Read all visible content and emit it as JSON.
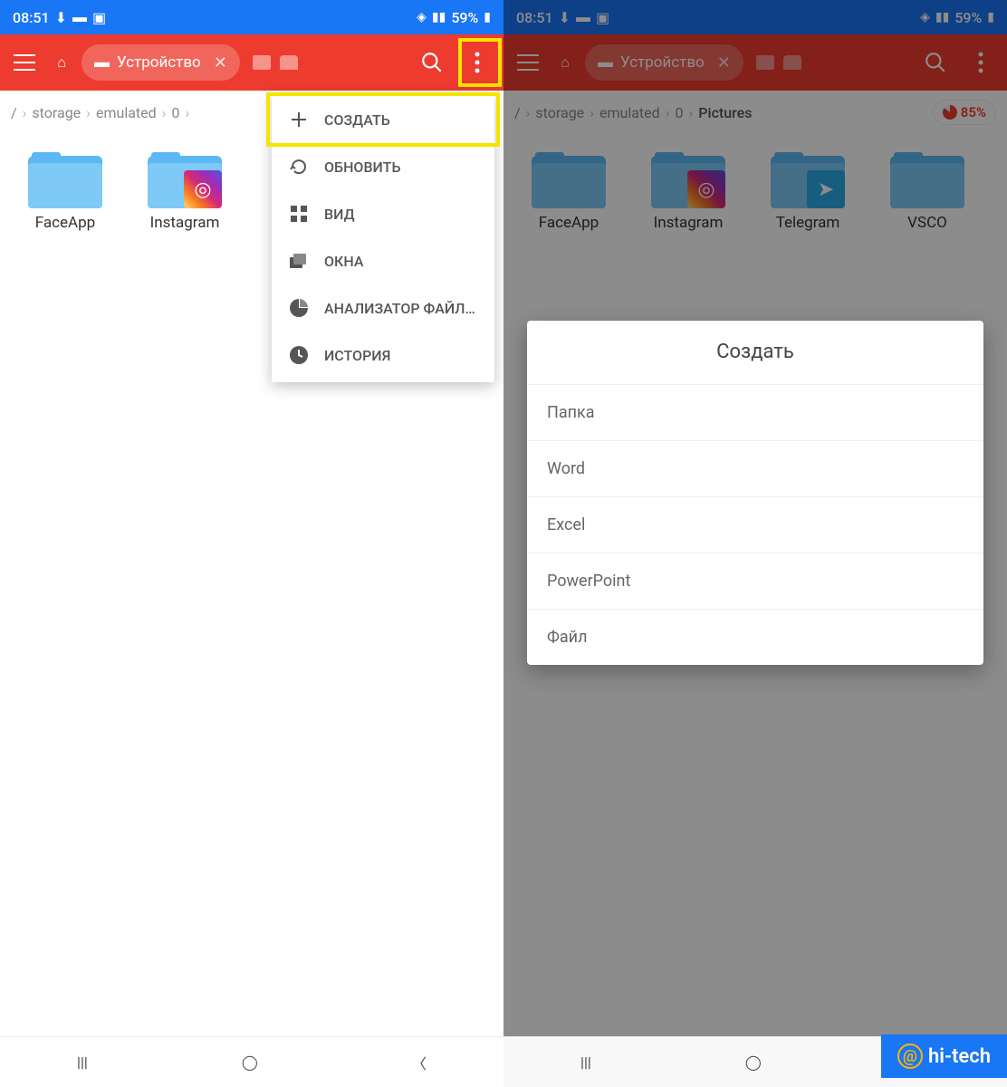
{
  "status": {
    "time": "08:51",
    "battery": "59%"
  },
  "appbar": {
    "device_label": "Устройство"
  },
  "breadcrumb_left": [
    "storage",
    "emulated",
    "0"
  ],
  "breadcrumb_right": [
    "storage",
    "emulated",
    "0",
    "Pictures"
  ],
  "storage_pct": "85%",
  "folders_left": [
    {
      "name": "FaceApp",
      "overlay": null
    },
    {
      "name": "Instagram",
      "overlay": "ig"
    }
  ],
  "folders_right": [
    {
      "name": "FaceApp",
      "overlay": null
    },
    {
      "name": "Instagram",
      "overlay": "ig"
    },
    {
      "name": "Telegram",
      "overlay": "tg"
    },
    {
      "name": "VSCO",
      "overlay": null
    }
  ],
  "menu": {
    "create": "СОЗДАТЬ",
    "refresh": "ОБНОВИТЬ",
    "view": "ВИД",
    "windows": "ОКНА",
    "analyzer": "АНАЛИЗАТОР ФАЙЛ…",
    "history": "ИСТОРИЯ"
  },
  "dialog": {
    "title": "Создать",
    "items": [
      "Папка",
      "Word",
      "Excel",
      "PowerPoint",
      "Файл"
    ]
  },
  "watermark": "hi-tech"
}
